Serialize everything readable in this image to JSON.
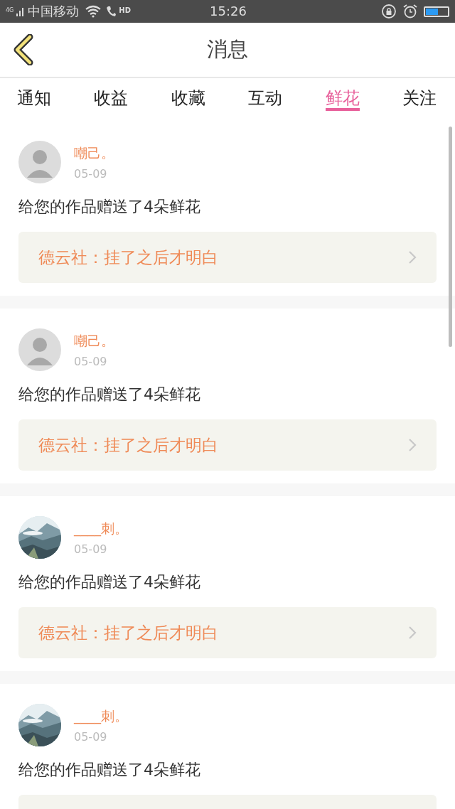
{
  "status_bar": {
    "network": "4G",
    "carrier": "中国移动",
    "call_badge": "HD",
    "time": "15:26"
  },
  "header": {
    "title": "消息"
  },
  "tabs": [
    {
      "label": "通知",
      "selected": false
    },
    {
      "label": "收益",
      "selected": false
    },
    {
      "label": "收藏",
      "selected": false
    },
    {
      "label": "互动",
      "selected": false
    },
    {
      "label": "鲜花",
      "selected": true
    },
    {
      "label": "关注",
      "selected": false
    }
  ],
  "messages": [
    {
      "avatar": {
        "kind": "silhouette"
      },
      "user": "嘲己。",
      "date": "05-09",
      "text": "给您的作品赠送了4朵鲜花",
      "work": "德云社：挂了之后才明白"
    },
    {
      "avatar": {
        "kind": "silhouette"
      },
      "user": "嘲己。",
      "date": "05-09",
      "text": "给您的作品赠送了4朵鲜花",
      "work": "德云社：挂了之后才明白"
    },
    {
      "user": "____刺。",
      "date": "05-09",
      "text": "给您的作品赠送了4朵鲜花",
      "work": "德云社：挂了之后才明白"
    },
    {
      "user": "____刺。",
      "date": "05-09",
      "text": "给您的作品赠送了4朵鲜花"
    }
  ]
}
